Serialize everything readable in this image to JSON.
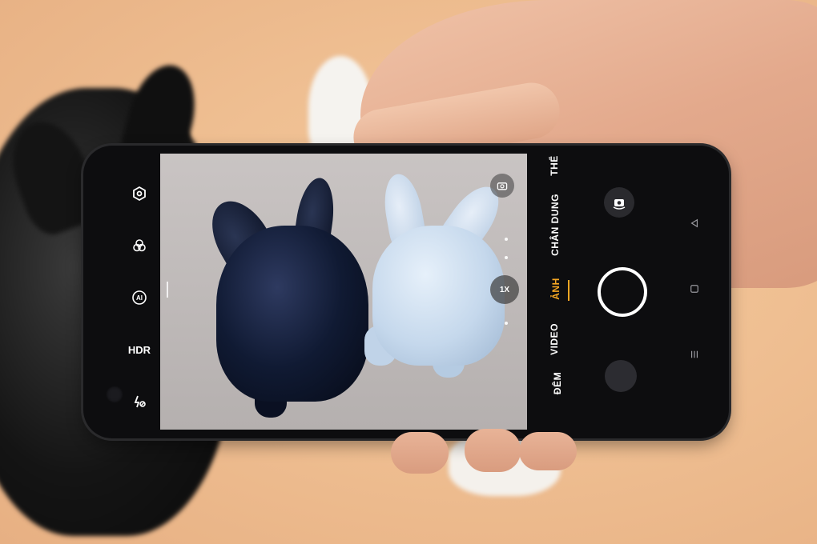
{
  "left_toolbar": {
    "hdr_label": "HDR",
    "ai_label": "AI"
  },
  "viewfinder": {
    "zoom_level": "1X"
  },
  "modes": {
    "items": [
      "ĐÊM",
      "VIDEO",
      "ẢNH",
      "CHÂN DUNG",
      "THỂ"
    ],
    "active": "ẢNH"
  },
  "colors": {
    "accent": "#f5a623",
    "phone_body": "#0d0d0f",
    "background": "#efbf92"
  },
  "icons": {
    "settings": "hexagon-settings-icon",
    "filters": "filter-circles-icon",
    "ai": "ai-icon",
    "hdr": "hdr-icon",
    "flash": "flash-off-icon",
    "switch": "camera-switch-icon",
    "flip": "flip-camera-icon"
  }
}
